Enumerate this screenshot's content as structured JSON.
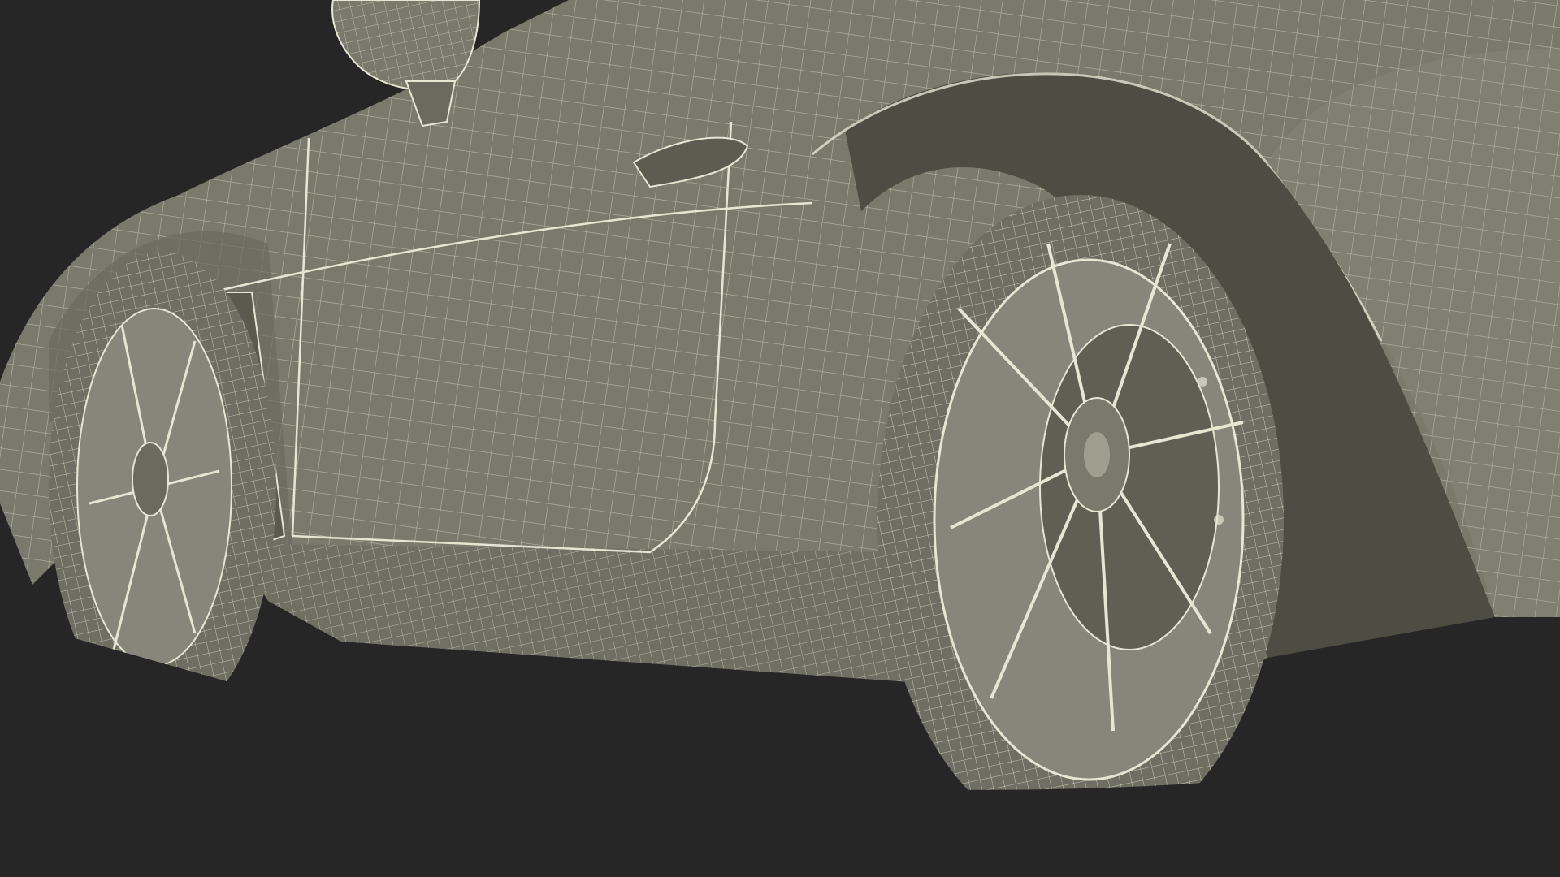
{
  "scene": {
    "subject": "car-wireframe-render",
    "colors": {
      "background": "#262626",
      "surface": "#7a7a6c",
      "surface_dark": "#5c5c50",
      "surface_shadow": "#45453c",
      "wire": "#e6e6d2",
      "tire": "#6e6e62",
      "rim": "#86867a"
    }
  }
}
